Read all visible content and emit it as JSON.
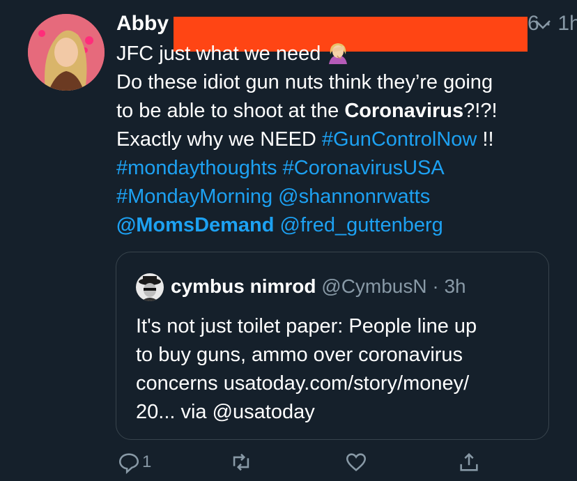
{
  "tweet": {
    "author_name": "Abby",
    "meta": "6 · 1h",
    "icons": {
      "avatar": "profile-photo",
      "more": "chevron-down-icon",
      "emoji": "person-facepalming-emoji"
    },
    "colors": {
      "background": "#15202b",
      "link": "#1da1f2",
      "muted": "#8899a6",
      "redaction": "#ff4514"
    },
    "lines": [
      {
        "segments": [
          {
            "text": "JFC just what we need",
            "style": "plain"
          }
        ],
        "emoji": true
      },
      {
        "segments": [
          {
            "text": "Do these idiot gun nuts think they’re going",
            "style": "plain"
          }
        ]
      },
      {
        "segments": [
          {
            "text": "to be able to shoot at the ",
            "style": "plain"
          },
          {
            "text": "Coronavirus",
            "style": "bold"
          },
          {
            "text": "?!?!",
            "style": "plain"
          }
        ]
      },
      {
        "segments": [
          {
            "text": "Exactly why we NEED ",
            "style": "plain"
          },
          {
            "text": "#GunControlNow",
            "style": "link"
          },
          {
            "text": " !!",
            "style": "plain"
          }
        ]
      },
      {
        "segments": [
          {
            "text": "#mondaythoughts",
            "style": "link"
          },
          {
            "text": " ",
            "style": "plain"
          },
          {
            "text": "#CoronavirusUSA",
            "style": "link"
          }
        ]
      },
      {
        "segments": [
          {
            "text": "#MondayMorning",
            "style": "link"
          },
          {
            "text": " ",
            "style": "plain"
          },
          {
            "text": "@shannonrwatts",
            "style": "link"
          }
        ]
      },
      {
        "segments": [
          {
            "text": "@MomsDemand",
            "style": "link-bold"
          },
          {
            "text": " ",
            "style": "plain"
          },
          {
            "text": "@fred_guttenberg",
            "style": "link"
          }
        ]
      }
    ]
  },
  "quote": {
    "name": "cymbus nimrod",
    "handle": "@CymbusN · 3h",
    "lines": [
      "It's not just toilet paper:  People line up",
      "to buy guns, ammo over coronavirus",
      "concerns usatoday.com/story/money/",
      "20... via @usatoday"
    ]
  },
  "actions": {
    "reply_count": "1",
    "icons": [
      "reply-icon",
      "retweet-icon",
      "like-icon",
      "share-icon"
    ]
  }
}
